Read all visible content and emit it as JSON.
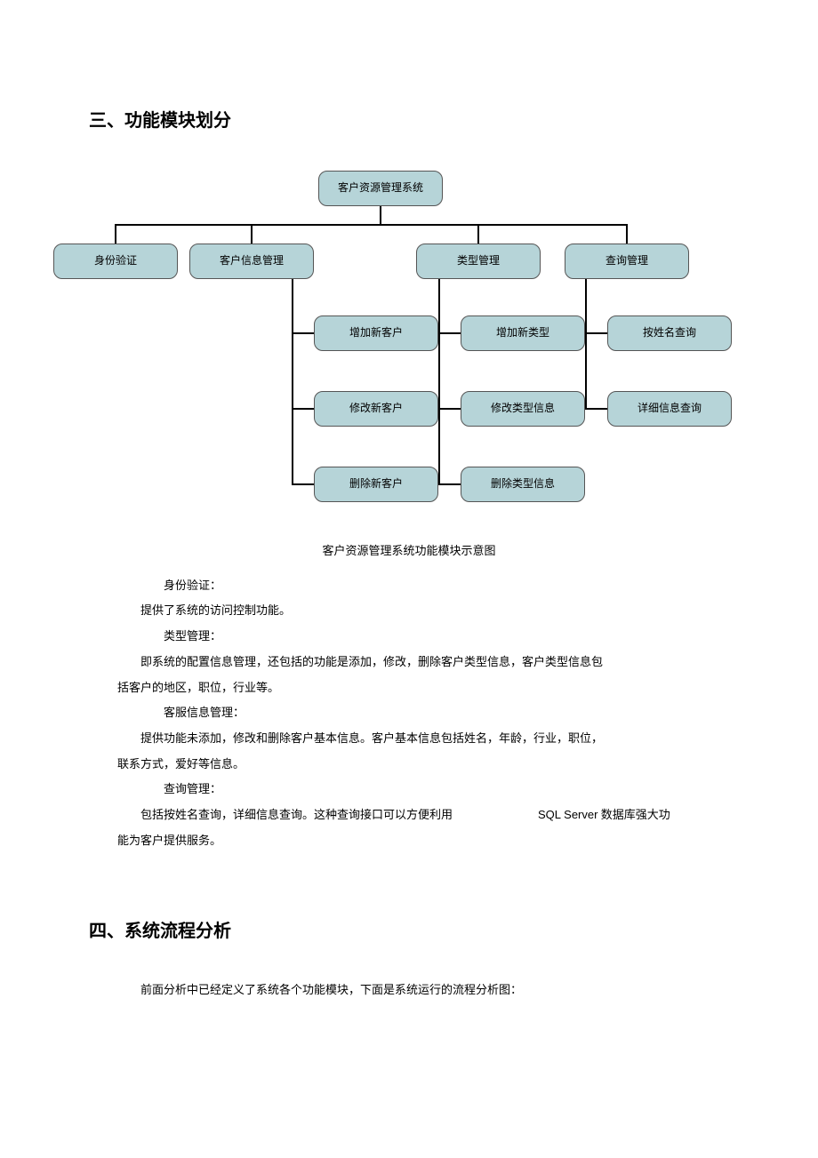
{
  "section3": {
    "heading": "三、功能模块划分",
    "diagram": {
      "root": "客户资源管理系统",
      "level2": {
        "identity": "身份验证",
        "customer": "客户信息管理",
        "type": "类型管理",
        "query": "查询管理"
      },
      "customer_children": {
        "add": "增加新客户",
        "modify": "修改新客户",
        "delete": "删除新客户"
      },
      "type_children": {
        "add": "增加新类型",
        "modify": "修改类型信息",
        "delete": "删除类型信息"
      },
      "query_children": {
        "byname": "按姓名查询",
        "detail": "详细信息查询"
      }
    },
    "caption": "客户资源管理系统功能模块示意图",
    "body": {
      "identity_label": "身份验证：",
      "identity_text": "提供了系统的访问控制功能。",
      "type_label": "类型管理：",
      "type_text1": "即系统的配置信息管理，还包括的功能是添加，修改，删除客户类型信息，客户类型信息包",
      "type_text2": "括客户的地区，职位，行业等。",
      "cust_label": "客服信息管理：",
      "cust_text1": "提供功能未添加，修改和删除客户基本信息。客户基本信息包括姓名，年龄，行业，职位，",
      "cust_text2": "联系方式，爱好等信息。",
      "query_label": "查询管理：",
      "query_text1a": "包括按姓名查询，详细信息查询。这种查询接口可以方便利用",
      "query_sql": "SQL Server",
      "query_text1b": " 数据库强大功",
      "query_text2": "能为客户提供服务。"
    }
  },
  "section4": {
    "heading": "四、系统流程分析",
    "text": "前面分析中已经定义了系统各个功能模块，下面是系统运行的流程分析图："
  }
}
